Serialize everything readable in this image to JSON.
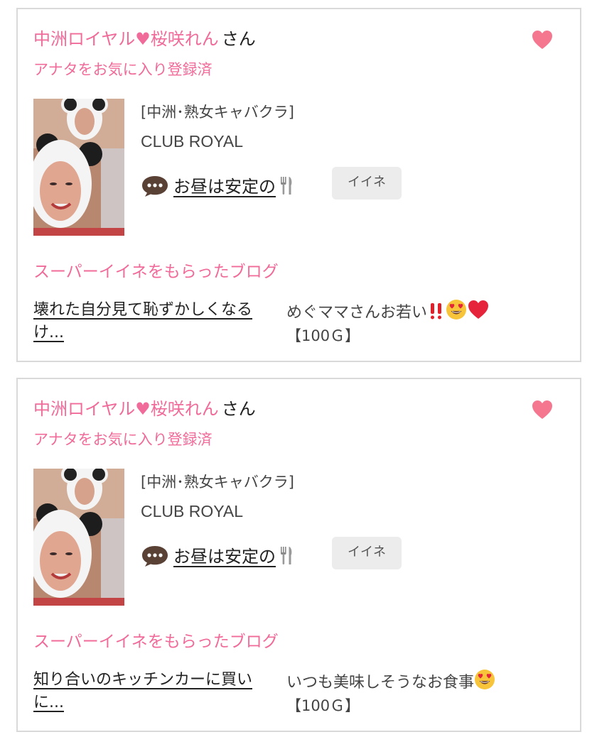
{
  "cards": [
    {
      "shop_name": "中洲ロイヤル♥桜咲れん",
      "honorific": "さん",
      "favorite_status": "アナタをお気に入り登録済",
      "category": "[中洲･熟女キャバクラ]",
      "brand": "CLUB ROYAL",
      "blog_title": "お昼は安定の",
      "iine_label": "イイネ",
      "super_heading": "スーパーイイネをもらったブログ",
      "super_blog_title": "壊れた自分見て恥ずかしくなるけ...",
      "super_comment": "めぐママさんお若い",
      "super_comment_emojis": [
        "double-exclamation-icon",
        "heart-eyes-face-icon",
        "red-heart-icon"
      ],
      "points": "【100Ｇ】"
    },
    {
      "shop_name": "中洲ロイヤル♥桜咲れん",
      "honorific": "さん",
      "favorite_status": "アナタをお気に入り登録済",
      "category": "[中洲･熟女キャバクラ]",
      "brand": "CLUB ROYAL",
      "blog_title": "お昼は安定の",
      "iine_label": "イイネ",
      "super_heading": "スーパーイイネをもらったブログ",
      "super_blog_title": "知り合いのキッチンカーに買いに...",
      "super_comment": "いつも美味しそうなお食事",
      "super_comment_emojis": [
        "heart-eyes-face-icon"
      ],
      "points": "【100Ｇ】"
    }
  ],
  "icons": {
    "favorite": "heart-icon",
    "comment": "speech-bubble-icon",
    "blog_title_suffix": "fork-and-knife-icon"
  },
  "colors": {
    "accent_pink": "#f06b9a",
    "card_border": "#d9d9d9",
    "button_bg": "#ececec"
  }
}
